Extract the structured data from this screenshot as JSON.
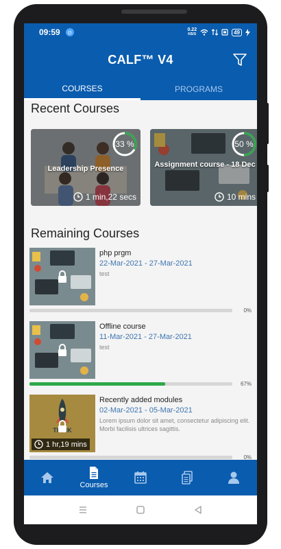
{
  "status": {
    "time": "09:59",
    "net_speed_top": "0.22",
    "net_speed_unit": "KB/S",
    "battery": "49"
  },
  "appbar": {
    "title": "CALF™ V4",
    "filter_icon": "filter-icon"
  },
  "tabs": [
    {
      "label": "COURSES",
      "active": true
    },
    {
      "label": "PROGRAMS",
      "active": false
    }
  ],
  "recent": {
    "heading": "Recent Courses",
    "cards": [
      {
        "name": "Leadership Presence",
        "percent": "33 %",
        "progress": 0.33,
        "duration": "1 min,22 secs"
      },
      {
        "name": "Assignment course - 18 Dec",
        "percent": "50 %",
        "progress": 0.5,
        "duration": "10 mins"
      }
    ]
  },
  "remaining": {
    "heading": "Remaining Courses",
    "items": [
      {
        "name": "php prgm",
        "dates": "22-Mar-2021  -  27-Mar-2021",
        "desc": "test",
        "progress": 0,
        "percent": "0%"
      },
      {
        "name": "Offline course",
        "dates": "11-Mar-2021  -  27-Mar-2021",
        "desc": "test",
        "progress": 0.67,
        "percent": "67%"
      },
      {
        "name": "Recently added modules",
        "dates": "02-Mar-2021  -  05-Mar-2021",
        "desc": "Lorem ipsum dolor sit amet, consectetur adipiscing elit. Morbi facilisis ultrices sagittis.",
        "thumb_text": "THINK",
        "duration": "1 hr,19 mins",
        "progress": 0,
        "percent": "0%"
      }
    ]
  },
  "bottom_nav": [
    {
      "icon": "home-icon",
      "label": ""
    },
    {
      "icon": "document-icon",
      "label": "Courses",
      "active": true
    },
    {
      "icon": "calendar-icon",
      "label": ""
    },
    {
      "icon": "files-icon",
      "label": ""
    },
    {
      "icon": "profile-icon",
      "label": ""
    }
  ],
  "colors": {
    "primary": "#0a5cae",
    "progress_green": "#2ea84a",
    "date_blue": "#3d74b0"
  }
}
